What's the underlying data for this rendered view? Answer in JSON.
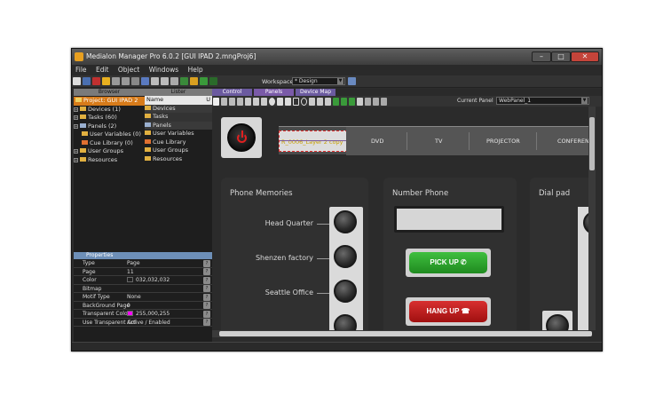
{
  "window": {
    "title": "Medialon Manager Pro 6.0.2  [GUI IPAD 2.mngProj6]",
    "min": "–",
    "max": "□",
    "close": "✕"
  },
  "menu": [
    "File",
    "Edit",
    "Object",
    "Windows",
    "Help"
  ],
  "toolbar": {
    "workspace_label": "Workspace",
    "workspace_value": "* Design"
  },
  "browser": {
    "tab": "Browser",
    "project": "Project: GUI IPAD 2",
    "items": [
      {
        "label": "Devices (1)",
        "exp": "+"
      },
      {
        "label": "Tasks (60)",
        "exp": "+"
      },
      {
        "label": "Panels (2)",
        "exp": "+"
      },
      {
        "label": "User Variables (0)",
        "exp": ""
      },
      {
        "label": "Cue Library (0)",
        "exp": ""
      },
      {
        "label": "User Groups",
        "exp": "+"
      },
      {
        "label": "Resources",
        "exp": "+"
      }
    ]
  },
  "lister": {
    "tab": "Lister",
    "col_name": "Name",
    "col_u": "U",
    "items": [
      "Devices",
      "Tasks",
      "Panels",
      "User Variables",
      "Cue Library",
      "User Groups",
      "Resources"
    ]
  },
  "properties": {
    "tab": "Properties",
    "rows": [
      {
        "key": "Type",
        "val": "Page"
      },
      {
        "key": "Page",
        "val": "11"
      },
      {
        "key": "Color",
        "val": "032,032,032"
      },
      {
        "key": "Bitmap",
        "val": ""
      },
      {
        "key": "Motif Type",
        "val": "None"
      },
      {
        "key": "BackGround Page",
        "val": "0"
      },
      {
        "key": "Transparent Color",
        "val": "255,000,255"
      },
      {
        "key": "Use Transparent Col",
        "val": "Active / Enabled"
      }
    ]
  },
  "panel_tabs": [
    "Control",
    "Panels",
    "Device Map"
  ],
  "panel_toolbar": {
    "current_panel_label": "Current Panel",
    "current_panel_value": "WebPanel_1"
  },
  "canvas": {
    "strip_text": "R_0006_Layer 2 copy",
    "nav": [
      "DVD",
      "TV",
      "PROJECTOR",
      "CONFERENCE"
    ],
    "phone_memories": {
      "title": "Phone Memories",
      "items": [
        "Head Quarter",
        "Shenzen factory",
        "Seattle Office"
      ]
    },
    "number_phone": {
      "title": "Number Phone",
      "pickup": "PICK UP",
      "hangup": "HANG UP"
    },
    "dial_pad": {
      "title": "Dial pad"
    }
  },
  "colors": {
    "accent_orange": "#e88a1a",
    "pickup_green": "#2fa52f",
    "hangup_red": "#c81e1e",
    "panel_tab_purple": "#7a5aa8"
  }
}
